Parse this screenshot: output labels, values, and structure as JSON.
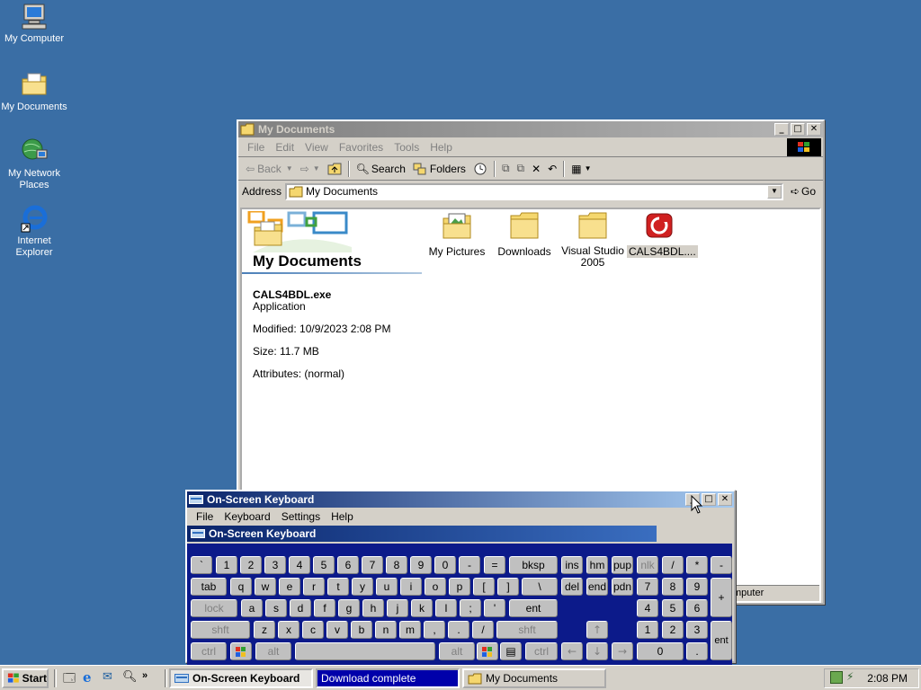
{
  "desktop": {
    "icons": [
      {
        "label": "My Computer"
      },
      {
        "label": "My Documents"
      },
      {
        "label": "My Network Places"
      },
      {
        "label": "Internet Explorer"
      }
    ]
  },
  "explorer": {
    "title": "My Documents",
    "menu": [
      "File",
      "Edit",
      "View",
      "Favorites",
      "Tools",
      "Help"
    ],
    "toolbar": {
      "back": "Back",
      "search": "Search",
      "folders": "Folders"
    },
    "address_label": "Address",
    "address_value": "My Documents",
    "go_label": "Go",
    "panel": {
      "heading": "My Documents",
      "filename": "CALS4BDL.exe",
      "type": "Application",
      "modified": "Modified: 10/9/2023 2:08 PM",
      "size": "Size: 11.7 MB",
      "attributes": "Attributes: (normal)"
    },
    "items": [
      {
        "label": "My Pictures"
      },
      {
        "label": "Downloads"
      },
      {
        "label": "Visual Studio 2005"
      },
      {
        "label": "CALS4BDL...."
      }
    ],
    "status_text": "mputer"
  },
  "osk": {
    "title": "On-Screen Keyboard",
    "menu": [
      "File",
      "Keyboard",
      "Settings",
      "Help"
    ],
    "banner": "On-Screen Keyboard",
    "rows": {
      "r1": [
        "`",
        "1",
        "2",
        "3",
        "4",
        "5",
        "6",
        "7",
        "8",
        "9",
        "0",
        "-",
        "=",
        "bksp",
        "ins",
        "hm",
        "pup",
        "nlk",
        "/",
        "*",
        "-"
      ],
      "r2": [
        "tab",
        "q",
        "w",
        "e",
        "r",
        "t",
        "y",
        "u",
        "i",
        "o",
        "p",
        "[",
        "]",
        "\\",
        "del",
        "end",
        "pdn",
        "7",
        "8",
        "9",
        "+"
      ],
      "r3": [
        "lock",
        "a",
        "s",
        "d",
        "f",
        "g",
        "h",
        "j",
        "k",
        "l",
        ";",
        "'",
        "ent",
        "4",
        "5",
        "6"
      ],
      "r4": [
        "shft",
        "z",
        "x",
        "c",
        "v",
        "b",
        "n",
        "m",
        ",",
        ".",
        "/",
        "shft",
        "↑",
        "1",
        "2",
        "3",
        "ent"
      ],
      "r5": [
        "ctrl",
        "alt",
        "alt",
        "ctrl",
        "←",
        "↓",
        "→",
        "0",
        "."
      ]
    }
  },
  "taskbar": {
    "start": "Start",
    "buttons": [
      "On-Screen Keyboard",
      "Download complete",
      "My Documents"
    ],
    "clock": "2:08 PM"
  },
  "colors": {
    "desktop": "#3a6ea5",
    "title_active": "#0a246a",
    "osk_bg": "#0c1a8a",
    "progress_blue": "#0000aa"
  }
}
